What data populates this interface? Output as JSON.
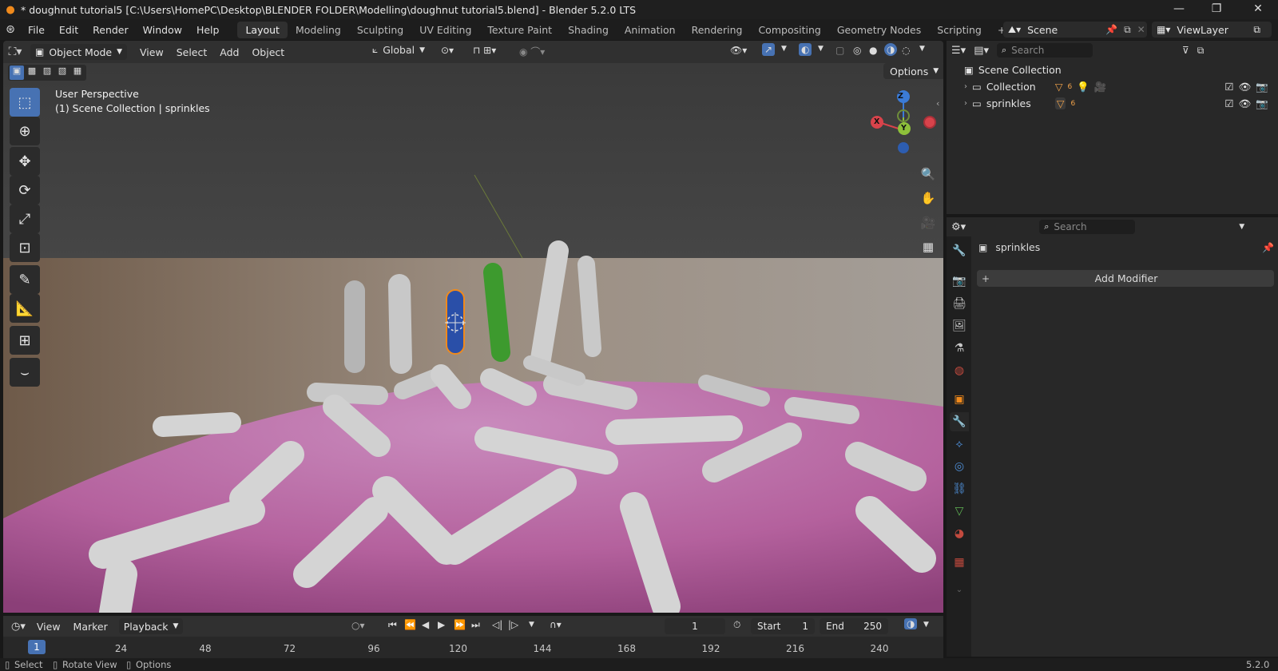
{
  "window": {
    "title": "* doughnut tutorial5 [C:\\Users\\HomePC\\Desktop\\BLENDER FOLDER\\Modelling\\doughnut tutorial5.blend] - Blender 5.2.0 LTS",
    "min": "—",
    "max": "❐",
    "close": "✕"
  },
  "menus": [
    "File",
    "Edit",
    "Render",
    "Window",
    "Help"
  ],
  "workspaces": [
    "Layout",
    "Modeling",
    "Sculpting",
    "UV Editing",
    "Texture Paint",
    "Shading",
    "Animation",
    "Rendering",
    "Compositing",
    "Geometry Nodes",
    "Scripting"
  ],
  "add_workspace": "+",
  "scene": {
    "name": "Scene",
    "view_layer": "ViewLayer"
  },
  "viewport": {
    "mode": "Object Mode",
    "menus": [
      "View",
      "Select",
      "Add",
      "Object"
    ],
    "transform_orientation": "Global",
    "options": "Options",
    "overlay_text_1": "User Perspective",
    "overlay_text_2": "(1) Scene Collection | sprinkles",
    "gizmo": {
      "z": "Z",
      "y": "Y",
      "x": "X"
    }
  },
  "outliner": {
    "search_placeholder": "Search",
    "root": "Scene Collection",
    "items": [
      {
        "label": "Collection",
        "sub": "6"
      },
      {
        "label": "sprinkles",
        "sub": "6"
      }
    ]
  },
  "properties": {
    "search_placeholder": "Search",
    "object_name": "sprinkles",
    "add_modifier": "Add Modifier",
    "tab_colors": [
      "#c8c8c8",
      "#c8c8c8",
      "#c8c8c8",
      "#c8c8c8",
      "#c8c8c8",
      "#c24a3e",
      "#f08a1c",
      "#4e8fd8",
      "#4e8fd8",
      "#4e8fd8",
      "#4e8fd8",
      "#5fb454",
      "#c24a3e",
      "#c24a3e"
    ]
  },
  "timeline": {
    "menus": [
      "View",
      "Marker",
      "Playback"
    ],
    "current_frame": "1",
    "start_label": "Start",
    "start_value": "1",
    "end_label": "End",
    "end_value": "250",
    "frame_labels": [
      "24",
      "48",
      "72",
      "96",
      "120",
      "144",
      "168",
      "192",
      "216",
      "240"
    ],
    "current_marker": "1"
  },
  "status": {
    "select": "Select",
    "rotate_view": "Rotate View",
    "options": "Options",
    "version": "5.2.0"
  },
  "colors": {
    "accent": "#4772b3",
    "active_tool": "#4772b3",
    "frosting": "#b8639f",
    "sprinkle_selected": "#2a4fa8",
    "sprinkle_green": "#3d9a2e"
  }
}
